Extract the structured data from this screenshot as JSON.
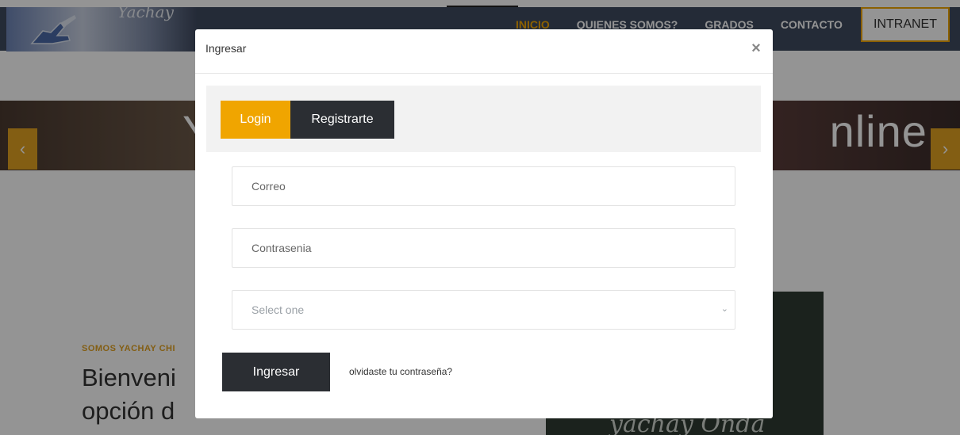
{
  "site": {
    "logo_script_text": "Yachay",
    "nav": {
      "items": [
        "INICIO",
        "QUIENES SOMOS?",
        "GRADOS",
        "CONTACTO"
      ],
      "intranet_label": "INTRANET",
      "active_color": "#f0a500"
    },
    "hero": {
      "text": "Y                                               nline",
      "prev_icon": "chevron-left-icon",
      "next_icon": "chevron-right-icon",
      "prev_glyph": "‹",
      "next_glyph": "›"
    },
    "intro": {
      "kicker": "SOMOS YACHAY CHI",
      "headline_line1": "Bienveni",
      "headline_line2": "opción d"
    },
    "board_text": "yachay Onda"
  },
  "modal": {
    "title": "Ingresar",
    "close_glyph": "×",
    "tabs": [
      {
        "label": "Login",
        "active": true
      },
      {
        "label": "Registrarte",
        "active": false
      }
    ],
    "fields": {
      "email_placeholder": "Correo",
      "password_placeholder": "Contrasenia",
      "select_placeholder": "Select one"
    },
    "submit_label": "Ingresar",
    "forgot_label": "olvidaste tu contraseña?"
  },
  "colors": {
    "accent": "#f0a500",
    "dark_button": "#2b2e33",
    "navbar": "#3f4a60"
  }
}
